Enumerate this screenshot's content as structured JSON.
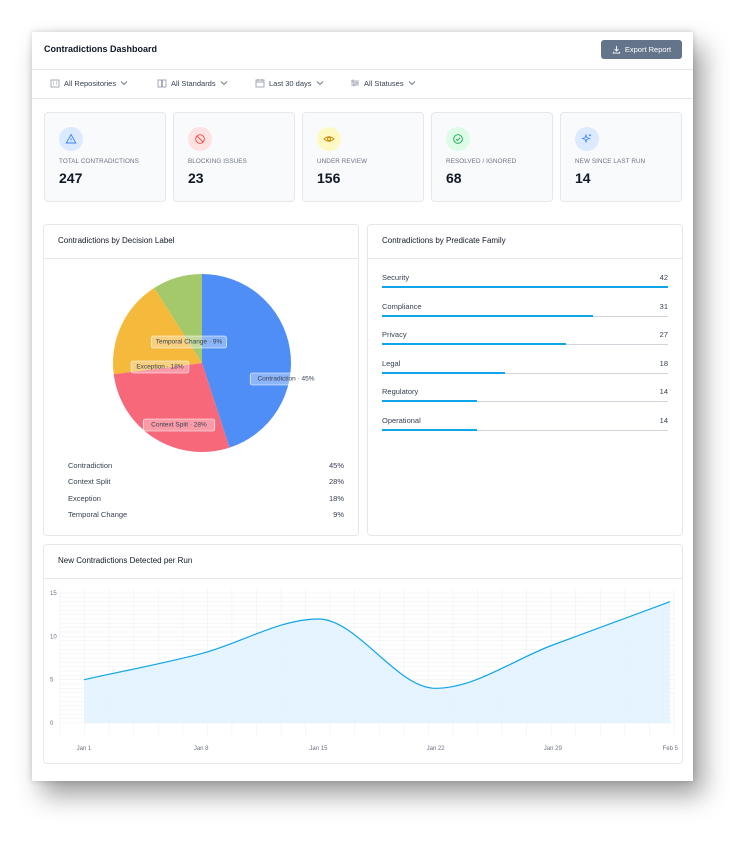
{
  "header": {
    "title": "Contradictions Dashboard",
    "export_label": "Export Report"
  },
  "filters": [
    {
      "label": "All Repositories",
      "icon": "building-icon"
    },
    {
      "label": "All Standards",
      "icon": "book-icon"
    },
    {
      "label": "Last 30 days",
      "icon": "calendar-icon"
    },
    {
      "label": "All Statuses",
      "icon": "sliders-icon"
    }
  ],
  "kpis": [
    {
      "label": "TOTAL CONTRADICTIONS",
      "value": "247",
      "icon": "warning-icon",
      "color": "#3b82f6",
      "bg": "#dbeafe"
    },
    {
      "label": "BLOCKING ISSUES",
      "value": "23",
      "icon": "block-icon",
      "color": "#ef4444",
      "bg": "#fee2e2"
    },
    {
      "label": "UNDER REVIEW",
      "value": "156",
      "icon": "eye-icon",
      "color": "#ca8a04",
      "bg": "#fef9c3"
    },
    {
      "label": "RESOLVED / IGNORED",
      "value": "68",
      "icon": "check-circle-icon",
      "color": "#16a34a",
      "bg": "#dcfce7"
    },
    {
      "label": "NEW SINCE LAST RUN",
      "value": "14",
      "icon": "sparkle-icon",
      "color": "#3b82f6",
      "bg": "#dbeafe"
    }
  ],
  "decision_card": {
    "title": "Contradictions by Decision Label",
    "legend": [
      {
        "name": "Contradiction",
        "pct": "45%"
      },
      {
        "name": "Context Split",
        "pct": "28%"
      },
      {
        "name": "Exception",
        "pct": "18%"
      },
      {
        "name": "Temporal Change",
        "pct": "9%"
      }
    ]
  },
  "predicate_card": {
    "title": "Contradictions by Predicate Family",
    "rows": [
      {
        "name": "Security",
        "count": "42",
        "value": 42
      },
      {
        "name": "Compliance",
        "count": "31",
        "value": 31
      },
      {
        "name": "Privacy",
        "count": "27",
        "value": 27
      },
      {
        "name": "Legal",
        "count": "18",
        "value": 18
      },
      {
        "name": "Regulatory",
        "count": "14",
        "value": 14
      },
      {
        "name": "Operational",
        "count": "14",
        "value": 14
      }
    ],
    "max": 42
  },
  "run_card": {
    "title": "New Contradictions Detected per Run"
  },
  "chart_data": [
    {
      "type": "pie",
      "categories": [
        "Contradiction",
        "Context Split",
        "Exception",
        "Temporal Change"
      ],
      "labels": [
        "Contradiction · 45%",
        "Context Split · 28%",
        "Exception · 18%",
        "Temporal Change · 9%"
      ],
      "values": [
        45,
        28,
        18,
        9
      ],
      "colors": [
        "#4f8ef7",
        "#f7687a",
        "#f5b93c",
        "#a3c96b"
      ]
    },
    {
      "type": "area",
      "categories": [
        "Jan 1",
        "Jan 8",
        "Jan 15",
        "Jan 22",
        "Jan 29",
        "Feb 5"
      ],
      "values": [
        5,
        8,
        12,
        4,
        9,
        14
      ],
      "y_ticks": [
        "0",
        "5",
        "10",
        "15"
      ],
      "ylim": [
        0,
        15
      ],
      "grid": true,
      "color": "#0ea5e9"
    }
  ]
}
